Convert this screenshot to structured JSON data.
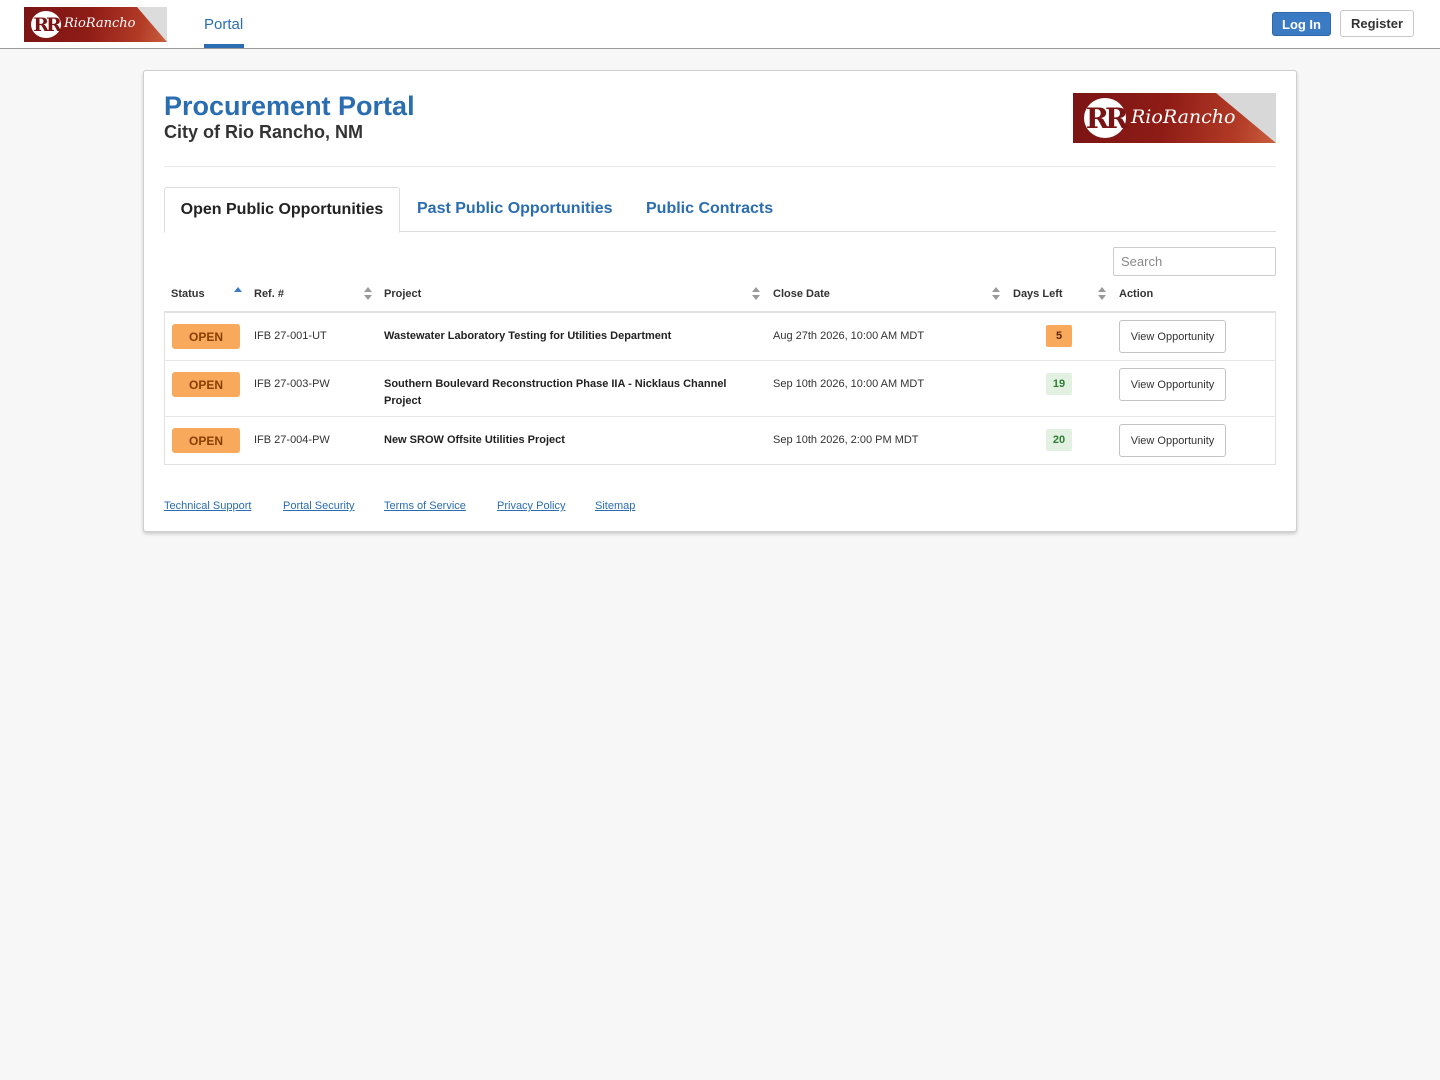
{
  "header": {
    "logo_text": "RioRancho",
    "nav_portal": "Portal",
    "login_label": "Log In",
    "register_label": "Register"
  },
  "page": {
    "title": "Procurement Portal",
    "subtitle": "City of Rio Rancho, NM"
  },
  "tabs": [
    {
      "label": "Open Public Opportunities",
      "active": true
    },
    {
      "label": "Past Public Opportunities",
      "active": false
    },
    {
      "label": "Public Contracts",
      "active": false
    }
  ],
  "search": {
    "placeholder": "Search",
    "value": ""
  },
  "table": {
    "columns": [
      "Status",
      "Ref. #",
      "Project",
      "Close Date",
      "Days Left",
      "Action"
    ],
    "sort": {
      "column": "Status",
      "direction": "ascending"
    },
    "rows": [
      {
        "status": "OPEN",
        "ref": "IFB 27-001-UT",
        "project": "Wastewater Laboratory Testing for Utilities Department",
        "close_date": "Aug 27th 2026, 10:00 AM MDT",
        "days_left": "5",
        "action": "View Opportunity"
      },
      {
        "status": "OPEN",
        "ref": "IFB 27-003-PW",
        "project_line1": "Southern Boulevard Reconstruction Phase IIA - Nicklaus Channel",
        "project_line2": "Project",
        "close_date": "Sep 10th 2026, 10:00 AM MDT",
        "days_left": "19",
        "action": "View Opportunity"
      },
      {
        "status": "OPEN",
        "ref": "IFB 27-004-PW",
        "project": "New SROW Offsite Utilities Project",
        "close_date": "Sep 10th 2026, 2:00 PM MDT",
        "days_left": "20",
        "action": "View Opportunity"
      }
    ]
  },
  "footer": {
    "links": [
      "Technical Support",
      "Portal Security",
      "Terms of Service",
      "Privacy Policy",
      "Sitemap"
    ]
  },
  "colors": {
    "brand_blue": "#2a6db0",
    "login_blue": "#3b7bc4",
    "logo_red": "#7a1414",
    "open_badge": "#f9a95b",
    "days_ok_bg": "#e3f1e3",
    "days_ok_text": "#2e7d32"
  }
}
